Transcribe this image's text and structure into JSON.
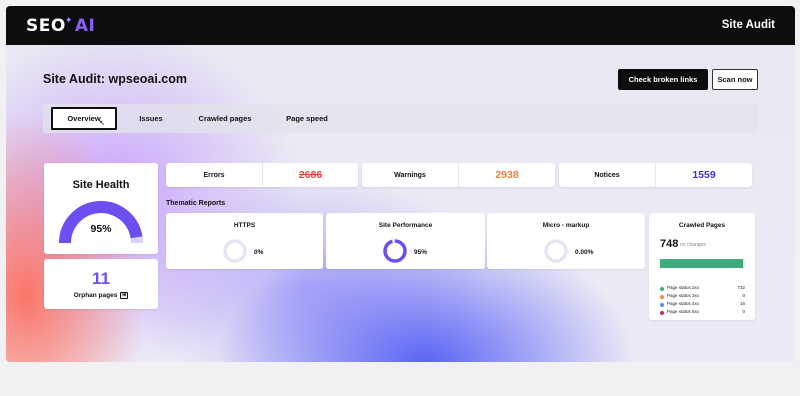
{
  "brand": {
    "logo_seo": "SEO",
    "logo_ai": "AI",
    "logo_spark": "✦"
  },
  "header": {
    "title": "Site Audit"
  },
  "page": {
    "title": "Site Audit: wpseoai.com"
  },
  "actions": {
    "check_broken_links": "Check broken links",
    "scan_now": "Scan now"
  },
  "tabs": [
    {
      "label": "Overview",
      "active": true
    },
    {
      "label": "Issues",
      "active": false
    },
    {
      "label": "Crawled pages",
      "active": false
    },
    {
      "label": "Page speed",
      "active": false
    }
  ],
  "site_health": {
    "title": "Site Health",
    "value": "95%",
    "fraction": 0.95,
    "gauge_color": "#6d4ef0",
    "track_color": "#d9d4fb"
  },
  "orphan": {
    "count": "11",
    "label": "Orphan pages"
  },
  "stats": [
    {
      "label": "Errors",
      "value": "2686",
      "color": "#d94b3d",
      "strike": true
    },
    {
      "label": "Warnings",
      "value": "2938",
      "color": "#ef7f3a",
      "strike": false
    },
    {
      "label": "Notices",
      "value": "1559",
      "color": "#3a35c8",
      "strike": false
    }
  ],
  "thematic": {
    "title": "Thematic Reports",
    "reports": [
      {
        "title": "HTTPS",
        "value": "0%",
        "fraction": 0.0
      },
      {
        "title": "Site Performance",
        "value": "95%",
        "fraction": 0.95
      },
      {
        "title": "Micro - markup",
        "value": "0.00%",
        "fraction": 0.0
      }
    ],
    "donut_color": "#6d4ef0",
    "donut_track": "#e6e4f3"
  },
  "crawled": {
    "title": "Crawled Pages",
    "count": "748",
    "subtitle": "no changes",
    "bar_fraction": 0.98,
    "legend": [
      {
        "label": "Page status 2xx",
        "value": "732",
        "color": "#3dab7c"
      },
      {
        "label": "Page status 3xx",
        "value": "0",
        "color": "#ef8a4a"
      },
      {
        "label": "Page status 4xx",
        "value": "16",
        "color": "#5b8de0"
      },
      {
        "label": "Page status 5xx",
        "value": "0",
        "color": "#b0336b"
      }
    ]
  }
}
